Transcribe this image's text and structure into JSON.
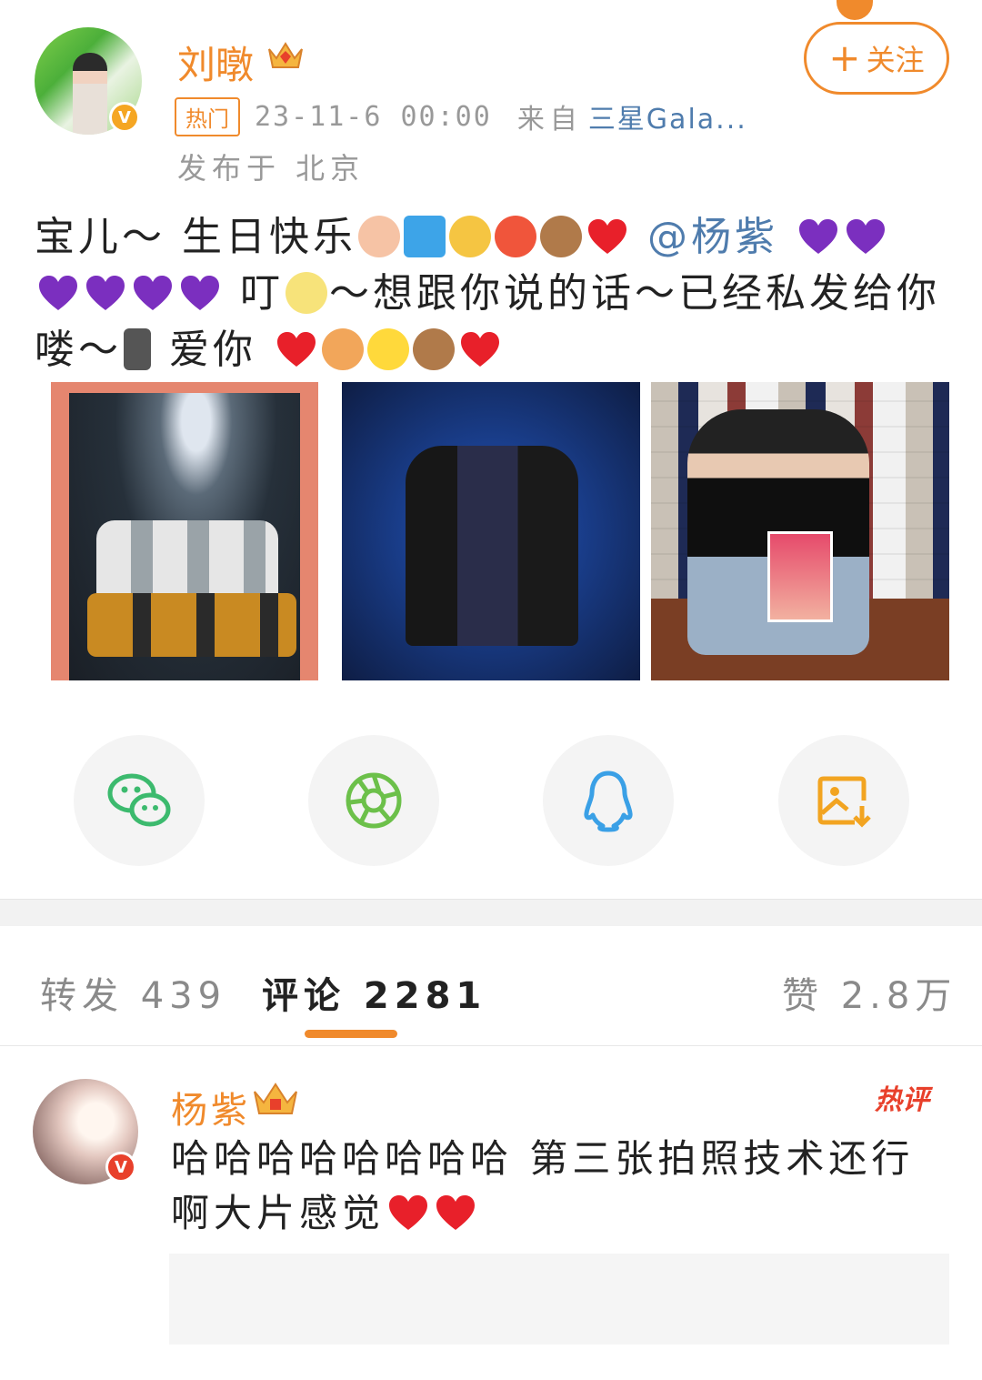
{
  "post": {
    "author": "刘暾",
    "hot_tag": "热门",
    "time": "23-11-6 00:00",
    "from_label": "来自",
    "device": "三星Gala...",
    "location": "发布于 北京",
    "follow_label": "关注",
    "text_parts": {
      "part1": "宝儿～ 生日快乐",
      "mention": "@杨紫",
      "part2": "叮",
      "part3": "～想跟你说的话～已经私发给你",
      "part4": "喽～",
      "part5": "爱你"
    }
  },
  "share": {
    "items": [
      "wechat-icon",
      "moments-icon",
      "qq-icon",
      "save-image-icon"
    ]
  },
  "tabs": {
    "repost": "转发 439",
    "comment": "评论 2281",
    "like": "赞 2.8万"
  },
  "comment": {
    "author": "杨紫",
    "badge": "热评",
    "text": "哈哈哈哈哈哈哈哈 第三张拍照技术还行啊大片感觉"
  },
  "colors": {
    "accent": "#f08a2c",
    "link": "#4f7cad",
    "hot_red": "#e8402b"
  }
}
